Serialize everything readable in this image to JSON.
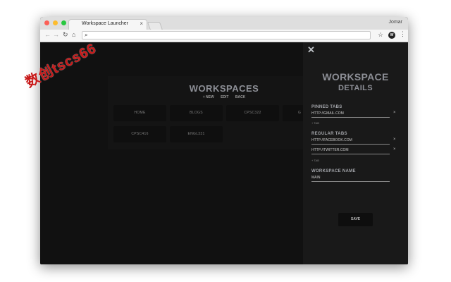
{
  "window": {
    "tab_title": "Workspace Launcher",
    "tab_close": "×",
    "user_name": "Jomar",
    "url": "",
    "icons": [
      "back-icon",
      "forward-icon",
      "reload-icon",
      "home-icon",
      "search-icon",
      "star-icon",
      "extension-icon",
      "menu-icon"
    ]
  },
  "workspaces": {
    "title": "WORKSPACES",
    "actions": {
      "new": "+ NEW",
      "edit": "EDIT",
      "back": "BACK"
    },
    "tiles": [
      "HOME",
      "BLOGS",
      "CPSC322",
      "CPSC416",
      "ENGL331"
    ],
    "partial_tile_text": "G"
  },
  "details": {
    "close": "✕",
    "title": "WORKSPACE",
    "subtitle": "DETAILS",
    "pinned_label": "PINNED TABS",
    "pinned": [
      "HTTP://GMAIL.COM"
    ],
    "regular_label": "REGULAR TABS",
    "regular": [
      "HTTP://FACEBOOK.COM",
      "HTTP://TWITTER.COM"
    ],
    "add_tab": "+ TAB",
    "remove": "×",
    "name_label": "WORKSPACE NAME",
    "name_value": "MAIN",
    "save": "SAVE"
  },
  "watermark": "数创tscs66",
  "colors": {
    "background": "#111111",
    "sidebar": "#191919",
    "heading": "#8d8f96",
    "watermark": "#c81818"
  }
}
